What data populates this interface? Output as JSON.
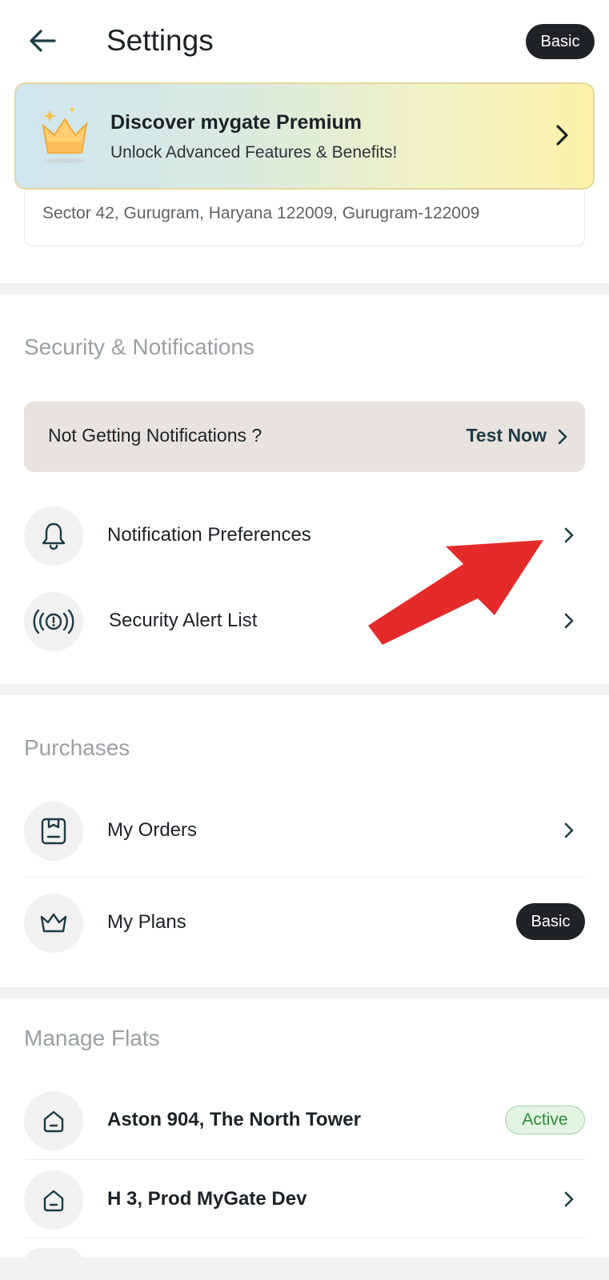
{
  "header": {
    "title": "Settings",
    "plan_badge": "Basic"
  },
  "premium_banner": {
    "title": "Discover mygate Premium",
    "subtitle": "Unlock Advanced Features & Benefits!"
  },
  "address": {
    "text": "Sector 42, Gurugram, Haryana 122009, Gurugram-122009"
  },
  "security_section": {
    "title": "Security & Notifications",
    "test_banner": {
      "question": "Not Getting Notifications ?",
      "action": "Test Now"
    },
    "items": [
      {
        "label": "Notification Preferences",
        "icon": "bell-icon"
      },
      {
        "label": "Security Alert List",
        "icon": "alert-signal-icon"
      }
    ]
  },
  "purchases_section": {
    "title": "Purchases",
    "items": [
      {
        "label": "My Orders",
        "icon": "orders-icon"
      },
      {
        "label": "My Plans",
        "icon": "crown-icon",
        "badge": "Basic"
      }
    ]
  },
  "flats_section": {
    "title": "Manage Flats",
    "items": [
      {
        "label": "Aston 904, The North Tower",
        "icon": "home-icon",
        "status": "Active"
      },
      {
        "label": "H 3, Prod MyGate Dev",
        "icon": "home-icon"
      }
    ]
  },
  "colors": {
    "accent_dark": "#1d3b45",
    "annotation_arrow": "#e52a2a",
    "active_green": "#2c8a3a"
  }
}
